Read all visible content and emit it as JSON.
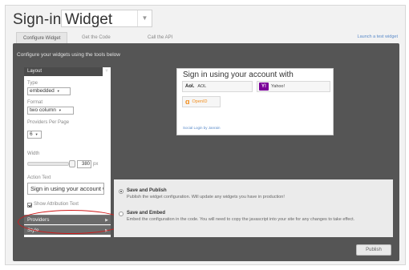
{
  "header": {
    "title": "Sign-in",
    "widget_select_value": "Widget"
  },
  "tabs": [
    {
      "label": "Configure Widget",
      "active": true
    },
    {
      "label": "Get the Code",
      "active": false
    },
    {
      "label": "Call the API",
      "active": false
    }
  ],
  "launch_link": "Launch a test widget",
  "panel_caption": "Configure your widgets using the tools below",
  "layout_section": {
    "header": "Layout",
    "type_label": "Type",
    "type_value": "embedded",
    "format_label": "Format",
    "format_value": "two column",
    "providers_per_page_label": "Providers Per Page",
    "providers_per_page_value": "6",
    "width_label": "Width",
    "width_value": "380",
    "width_unit": "px",
    "action_text_label": "Action Text",
    "action_text_value": "Sign in using your account with",
    "show_attribution_label": "Show Attribution Text",
    "show_attribution_checked": true
  },
  "sections": {
    "providers": "Providers",
    "style": "Style"
  },
  "preview": {
    "title": "Sign in using your account with",
    "providers": [
      {
        "logo": "Aol.",
        "name": "AOL"
      },
      {
        "logo": "Y!",
        "name": "Yahoo!"
      },
      {
        "logo": "OpenID",
        "name": "OpenID"
      }
    ],
    "footer_link": "Social Login by Janrain"
  },
  "publish_options": {
    "save_publish_title": "Save and Publish",
    "save_publish_desc": "Publish the widget configuration. Will update any widgets you have in production!",
    "save_embed_title": "Save and Embed",
    "save_embed_desc": "Embed the configuration in the code. You will need to copy the javascript into your site for any changes to take effect.",
    "selected": "save_publish"
  },
  "publish_button": "Publish",
  "colors": {
    "dark_panel": "#555555",
    "link": "#5b8bc9",
    "highlight_oval": "#d01c1c",
    "yahoo": "#7b0099",
    "openid": "#f28c1a"
  }
}
